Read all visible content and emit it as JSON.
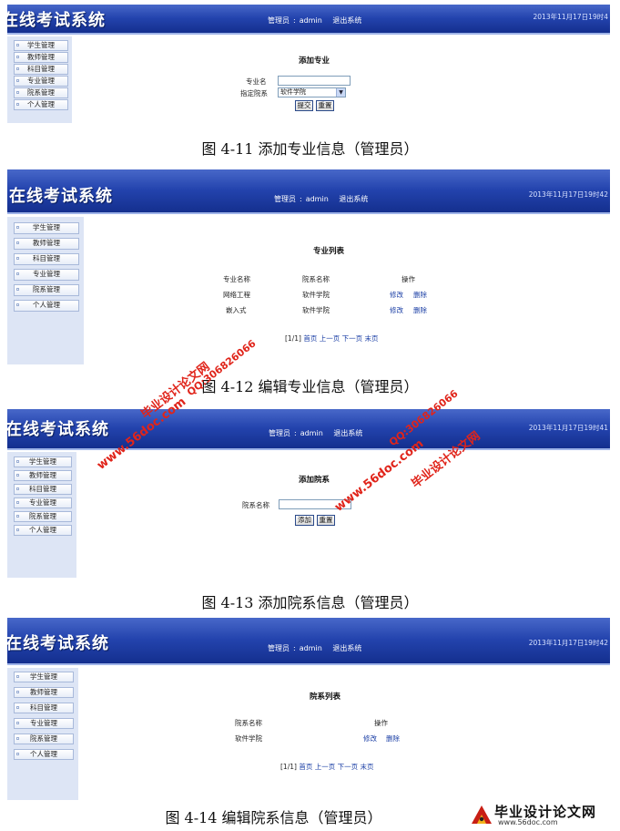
{
  "app": {
    "title": "在线考试系统",
    "nav": [
      "管理员",
      "admin",
      "退出系统"
    ],
    "nav_sep": ":",
    "datetime_1": "2013年11月17日19时4",
    "datetime_2": "2013年11月17日19时42",
    "datetime_3": "2013年11月17日19时41",
    "datetime_4": "2013年11月17日19时42",
    "menu": [
      "学生管理",
      "教师管理",
      "科目管理",
      "专业管理",
      "院系管理",
      "个人管理"
    ]
  },
  "screen1": {
    "heading": "添加专业",
    "major_name_label": "专业名",
    "major_name_value": "",
    "college_label": "指定院系",
    "college_selected": "软件学院",
    "submit_label": "提交",
    "reset_label": "重置",
    "caption": "图 4-11  添加专业信息（管理员）"
  },
  "screen2": {
    "heading": "专业列表",
    "columns": [
      "专业名称",
      "院系名称",
      "操作"
    ],
    "rows": [
      {
        "major": "网络工程",
        "college": "软件学院",
        "edit": "修改",
        "delete": "删除"
      },
      {
        "major": "嵌入式",
        "college": "软件学院",
        "edit": "修改",
        "delete": "删除"
      }
    ],
    "pager": {
      "info": "[1/1]",
      "first": "首页",
      "prev": "上一页",
      "next": "下一页",
      "last": "末页"
    },
    "caption": "图 4-12  编辑专业信息（管理员）"
  },
  "screen3": {
    "heading": "添加院系",
    "college_name_label": "院系名称",
    "college_name_value": "",
    "add_label": "添加",
    "reset_label": "重置",
    "caption": "图 4-13  添加院系信息（管理员）"
  },
  "screen4": {
    "heading": "院系列表",
    "columns": [
      "院系名称",
      "操作"
    ],
    "rows": [
      {
        "college": "软件学院",
        "edit": "修改",
        "delete": "删除"
      }
    ],
    "pager": {
      "info": "[1/1]",
      "first": "首页",
      "prev": "上一页",
      "next": "下一页",
      "last": "末页"
    },
    "caption": "图 4-14  编辑院系信息（管理员）"
  },
  "watermarks": {
    "site": "www.56doc.com",
    "brand": "毕业设计论文网",
    "qq": "QQ:306826066"
  },
  "logo": {
    "name": "毕业设计论文网",
    "url": "www.56doc.com"
  },
  "colors": {
    "header_blue": "#1f3ea6",
    "sidebar_bg": "#dde5f5",
    "link_blue": "#1a3ea5",
    "watermark_red": "#e0241a"
  }
}
